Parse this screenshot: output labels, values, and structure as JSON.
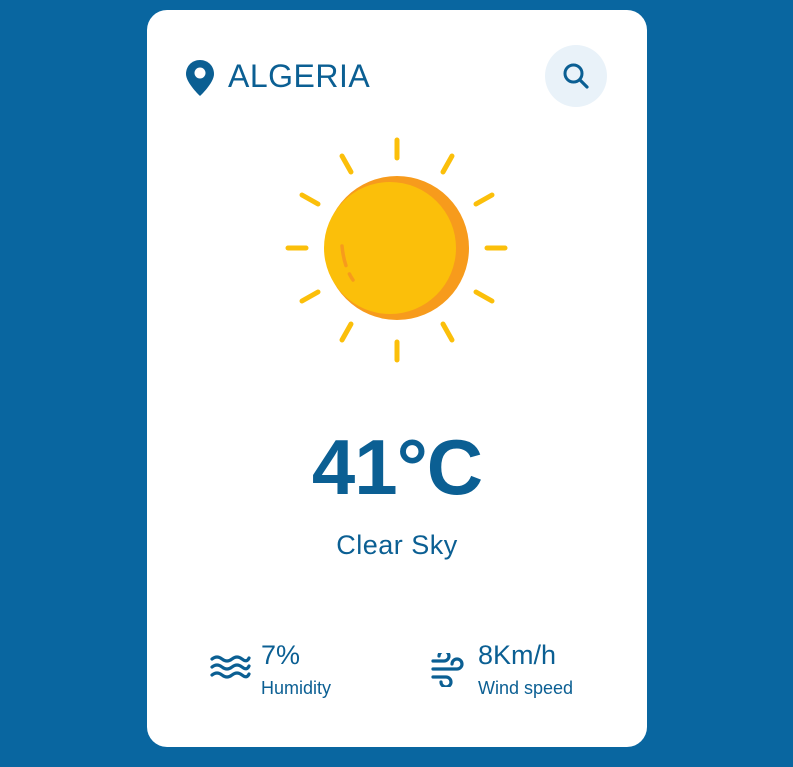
{
  "location": {
    "name": "ALGERIA",
    "icon": "map-pin-icon"
  },
  "search": {
    "icon": "search-icon"
  },
  "weather": {
    "icon": "sun-icon",
    "temperature": "41°C",
    "description": "Clear Sky"
  },
  "details": {
    "humidity": {
      "value": "7%",
      "label": "Humidity",
      "icon": "humidity-waves-icon"
    },
    "wind": {
      "value": "8Km/h",
      "label": "Wind speed",
      "icon": "wind-icon"
    }
  },
  "colors": {
    "background": "#0966a0",
    "card": "#ffffff",
    "text": "#0b5f93",
    "search_button_bg": "#e9f2f9",
    "sun": "#fbbf0a",
    "sun_shade": "#f79b1c"
  }
}
